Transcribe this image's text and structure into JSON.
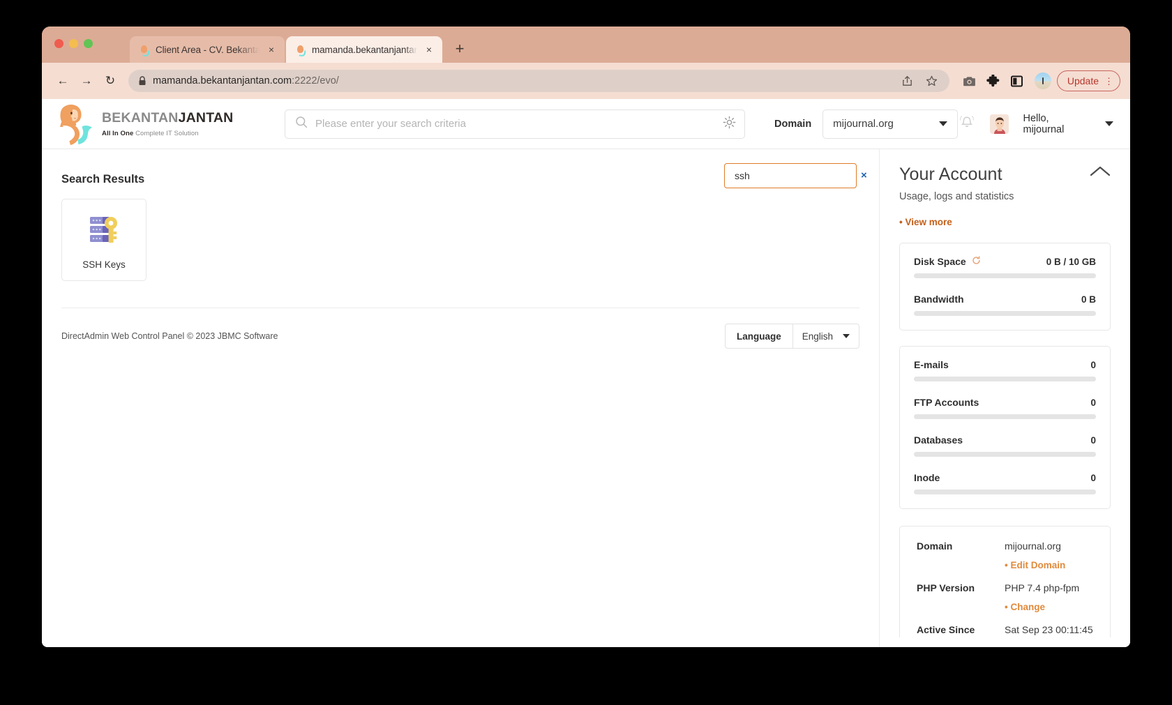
{
  "browser": {
    "tabs": [
      {
        "title": "Client Area - CV. Bekantan Jan",
        "favicon": "bekantan-favicon",
        "close": "×"
      },
      {
        "title": "mamanda.bekantanjantan.com",
        "favicon": "bekantan-favicon",
        "close": "×"
      }
    ],
    "new_tab": "+",
    "nav": {
      "back": "←",
      "forward": "→",
      "reload": "↻"
    },
    "address": {
      "url_main": "mamanda.bekantanjantan.com",
      "url_dim": ":2222/evo/"
    },
    "update_button": "Update",
    "update_kebab": "⋮"
  },
  "header": {
    "brand_name_light": "BEKANTAN",
    "brand_name_bold": "JANTAN",
    "tagline_bold": "All In One",
    "tagline_rest": "Complete IT Solution",
    "search_placeholder": "Please enter your search criteria",
    "search_value": "",
    "domain_label": "Domain",
    "domain_value": "mijournal.org",
    "hello_prefix": "Hello,",
    "hello_user": "mijournal"
  },
  "main": {
    "results_search_value": "ssh",
    "results_search_clear": "×",
    "heading": "Search Results",
    "results": [
      {
        "label": "SSH Keys",
        "icon": "ssh-keys-icon"
      }
    ],
    "footer": {
      "copyright": "DirectAdmin Web Control Panel © 2023 JBMC Software",
      "language_label": "Language",
      "language_value": "English"
    }
  },
  "aside": {
    "title": "Your Account",
    "subtitle": "Usage, logs and statistics",
    "view_more": "• View more",
    "usage": [
      {
        "name": "Disk Space",
        "value": "0 B / 10 GB",
        "refresh": true,
        "percent": 0
      },
      {
        "name": "Bandwidth",
        "value": "0 B",
        "refresh": false,
        "percent": 0
      }
    ],
    "counters": [
      {
        "name": "E-mails",
        "value": "0",
        "percent": 0
      },
      {
        "name": "FTP Accounts",
        "value": "0",
        "percent": 0
      },
      {
        "name": "Databases",
        "value": "0",
        "percent": 0
      },
      {
        "name": "Inode",
        "value": "0",
        "percent": 0
      }
    ],
    "info": [
      {
        "label": "Domain",
        "value": "mijournal.org",
        "action": "• Edit Domain"
      },
      {
        "label": "PHP Version",
        "value": "PHP 7.4 php-fpm",
        "action": "• Change"
      },
      {
        "label": "Active Since",
        "value": "Sat Sep 23 00:11:45",
        "action": ""
      }
    ]
  },
  "colors": {
    "accent_orange": "#e07b28",
    "link_orange": "#c4601c",
    "action_orange": "#e08a3c",
    "clear_blue": "#1f63b5",
    "browser_chrome": "#f5ddd2"
  }
}
